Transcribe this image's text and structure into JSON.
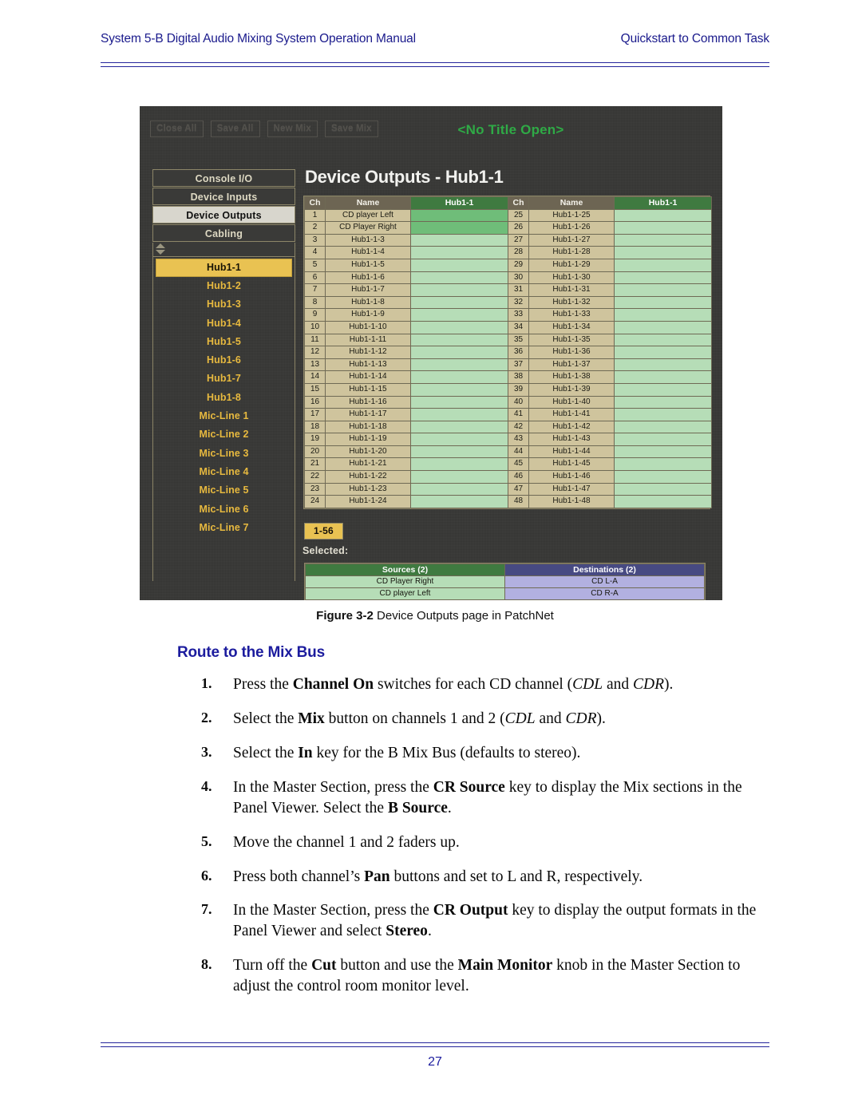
{
  "header": {
    "left": "System 5-B Digital Audio Mixing System Operation Manual",
    "right": "Quickstart to Common Task"
  },
  "figure": {
    "app": {
      "no_title": "<No Title Open>",
      "page_title": "Device Outputs - Hub1-1",
      "toolbar": [
        {
          "label": "Close All"
        },
        {
          "label": "Save All"
        },
        {
          "label": "New Mix"
        },
        {
          "label": "Save Mix"
        }
      ],
      "nav": [
        {
          "label": "Console I/O",
          "selected": false
        },
        {
          "label": "Device Inputs",
          "selected": false
        },
        {
          "label": "Device Outputs",
          "selected": true
        },
        {
          "label": "Cabling",
          "selected": false
        }
      ],
      "devices": [
        {
          "label": "Hub1-1",
          "selected": true
        },
        {
          "label": "Hub1-2",
          "selected": false
        },
        {
          "label": "Hub1-3",
          "selected": false
        },
        {
          "label": "Hub1-4",
          "selected": false
        },
        {
          "label": "Hub1-5",
          "selected": false
        },
        {
          "label": "Hub1-6",
          "selected": false
        },
        {
          "label": "Hub1-7",
          "selected": false
        },
        {
          "label": "Hub1-8",
          "selected": false
        },
        {
          "label": "Mic-Line 1",
          "selected": false
        },
        {
          "label": "Mic-Line 2",
          "selected": false
        },
        {
          "label": "Mic-Line 3",
          "selected": false
        },
        {
          "label": "Mic-Line 4",
          "selected": false
        },
        {
          "label": "Mic-Line 5",
          "selected": false
        },
        {
          "label": "Mic-Line 6",
          "selected": false
        },
        {
          "label": "Mic-Line 7",
          "selected": false
        }
      ],
      "grid": {
        "headers": [
          "Ch",
          "Name",
          "Hub1-1",
          "Ch",
          "Name",
          "Hub1-1"
        ],
        "rows": [
          {
            "ch_l": "1",
            "name_l": "CD player Left",
            "xp_l": true,
            "ch_r": "25",
            "name_r": "Hub1-1-25",
            "xp_r": false
          },
          {
            "ch_l": "2",
            "name_l": "CD Player Right",
            "xp_l": true,
            "ch_r": "26",
            "name_r": "Hub1-1-26",
            "xp_r": false
          },
          {
            "ch_l": "3",
            "name_l": "Hub1-1-3",
            "xp_l": false,
            "ch_r": "27",
            "name_r": "Hub1-1-27",
            "xp_r": false
          },
          {
            "ch_l": "4",
            "name_l": "Hub1-1-4",
            "xp_l": false,
            "ch_r": "28",
            "name_r": "Hub1-1-28",
            "xp_r": false
          },
          {
            "ch_l": "5",
            "name_l": "Hub1-1-5",
            "xp_l": false,
            "ch_r": "29",
            "name_r": "Hub1-1-29",
            "xp_r": false
          },
          {
            "ch_l": "6",
            "name_l": "Hub1-1-6",
            "xp_l": false,
            "ch_r": "30",
            "name_r": "Hub1-1-30",
            "xp_r": false
          },
          {
            "ch_l": "7",
            "name_l": "Hub1-1-7",
            "xp_l": false,
            "ch_r": "31",
            "name_r": "Hub1-1-31",
            "xp_r": false
          },
          {
            "ch_l": "8",
            "name_l": "Hub1-1-8",
            "xp_l": false,
            "ch_r": "32",
            "name_r": "Hub1-1-32",
            "xp_r": false
          },
          {
            "ch_l": "9",
            "name_l": "Hub1-1-9",
            "xp_l": false,
            "ch_r": "33",
            "name_r": "Hub1-1-33",
            "xp_r": false
          },
          {
            "ch_l": "10",
            "name_l": "Hub1-1-10",
            "xp_l": false,
            "ch_r": "34",
            "name_r": "Hub1-1-34",
            "xp_r": false
          },
          {
            "ch_l": "11",
            "name_l": "Hub1-1-11",
            "xp_l": false,
            "ch_r": "35",
            "name_r": "Hub1-1-35",
            "xp_r": false
          },
          {
            "ch_l": "12",
            "name_l": "Hub1-1-12",
            "xp_l": false,
            "ch_r": "36",
            "name_r": "Hub1-1-36",
            "xp_r": false
          },
          {
            "ch_l": "13",
            "name_l": "Hub1-1-13",
            "xp_l": false,
            "ch_r": "37",
            "name_r": "Hub1-1-37",
            "xp_r": false
          },
          {
            "ch_l": "14",
            "name_l": "Hub1-1-14",
            "xp_l": false,
            "ch_r": "38",
            "name_r": "Hub1-1-38",
            "xp_r": false
          },
          {
            "ch_l": "15",
            "name_l": "Hub1-1-15",
            "xp_l": false,
            "ch_r": "39",
            "name_r": "Hub1-1-39",
            "xp_r": false
          },
          {
            "ch_l": "16",
            "name_l": "Hub1-1-16",
            "xp_l": false,
            "ch_r": "40",
            "name_r": "Hub1-1-40",
            "xp_r": false
          },
          {
            "ch_l": "17",
            "name_l": "Hub1-1-17",
            "xp_l": false,
            "ch_r": "41",
            "name_r": "Hub1-1-41",
            "xp_r": false
          },
          {
            "ch_l": "18",
            "name_l": "Hub1-1-18",
            "xp_l": false,
            "ch_r": "42",
            "name_r": "Hub1-1-42",
            "xp_r": false
          },
          {
            "ch_l": "19",
            "name_l": "Hub1-1-19",
            "xp_l": false,
            "ch_r": "43",
            "name_r": "Hub1-1-43",
            "xp_r": false
          },
          {
            "ch_l": "20",
            "name_l": "Hub1-1-20",
            "xp_l": false,
            "ch_r": "44",
            "name_r": "Hub1-1-44",
            "xp_r": false
          },
          {
            "ch_l": "21",
            "name_l": "Hub1-1-21",
            "xp_l": false,
            "ch_r": "45",
            "name_r": "Hub1-1-45",
            "xp_r": false
          },
          {
            "ch_l": "22",
            "name_l": "Hub1-1-22",
            "xp_l": false,
            "ch_r": "46",
            "name_r": "Hub1-1-46",
            "xp_r": false
          },
          {
            "ch_l": "23",
            "name_l": "Hub1-1-23",
            "xp_l": false,
            "ch_r": "47",
            "name_r": "Hub1-1-47",
            "xp_r": false
          },
          {
            "ch_l": "24",
            "name_l": "Hub1-1-24",
            "xp_l": false,
            "ch_r": "48",
            "name_r": "Hub1-1-48",
            "xp_r": false
          }
        ]
      },
      "range_button": "1-56",
      "selected_label": "Selected:",
      "selected_table": {
        "headers": [
          "Sources (2)",
          "Destinations (2)"
        ],
        "rows": [
          {
            "source": "CD Player Right",
            "destination": "CD L-A"
          },
          {
            "source": "CD player Left",
            "destination": "CD R-A"
          }
        ]
      }
    }
  },
  "caption": {
    "label": "Figure 3-2",
    "text": "Device Outputs page in PatchNet"
  },
  "section": {
    "heading": "Route to the Mix Bus"
  },
  "steps": [
    {
      "num": "1."
    },
    {
      "num": "2."
    },
    {
      "num": "3."
    },
    {
      "num": "4."
    },
    {
      "num": "5."
    },
    {
      "num": "6."
    },
    {
      "num": "7."
    },
    {
      "num": "8."
    }
  ],
  "step_text": {
    "s1": {
      "a": "Press the ",
      "b1": "Channel On",
      "c": " switches for each CD channel (",
      "i1": "CDL",
      "d": " and ",
      "i2": "CDR",
      "e": ")."
    },
    "s2": {
      "a": "Select the ",
      "b1": "Mix",
      "c": " button on channels 1 and 2 (",
      "i1": "CDL",
      "d": " and ",
      "i2": "CDR",
      "e": ")."
    },
    "s3": {
      "a": "Select the ",
      "b1": "In",
      "c": " key for the B Mix Bus (defaults to stereo)."
    },
    "s4": {
      "a": "In the Master Section, press the ",
      "b1": "CR Source",
      "c": " key to display the Mix sections in the Panel Viewer. Select the ",
      "b2": "B Source",
      "d": "."
    },
    "s5": {
      "a": "Move the channel 1 and 2 faders up."
    },
    "s6": {
      "a": "Press both channel’s ",
      "b1": "Pan",
      "c": " buttons and set to L and R, respectively."
    },
    "s7": {
      "a": "In the Master Section, press the ",
      "b1": "CR Output",
      "c": " key to display the output formats in the Panel Viewer and select ",
      "b2": "Stereo",
      "d": "."
    },
    "s8": {
      "a": "Turn off the ",
      "b1": "Cut",
      "c": " button and use the ",
      "b2": "Main Monitor",
      "d": " knob in the Master Section to adjust the control room monitor level."
    }
  },
  "footer": {
    "page_number": "27"
  },
  "colors": {
    "accent_blue": "#1c1c9e",
    "source_green": "#3f7a40",
    "destination_blue": "#474a82",
    "selected_amber": "#e9c252",
    "status_green": "#2faa46"
  }
}
